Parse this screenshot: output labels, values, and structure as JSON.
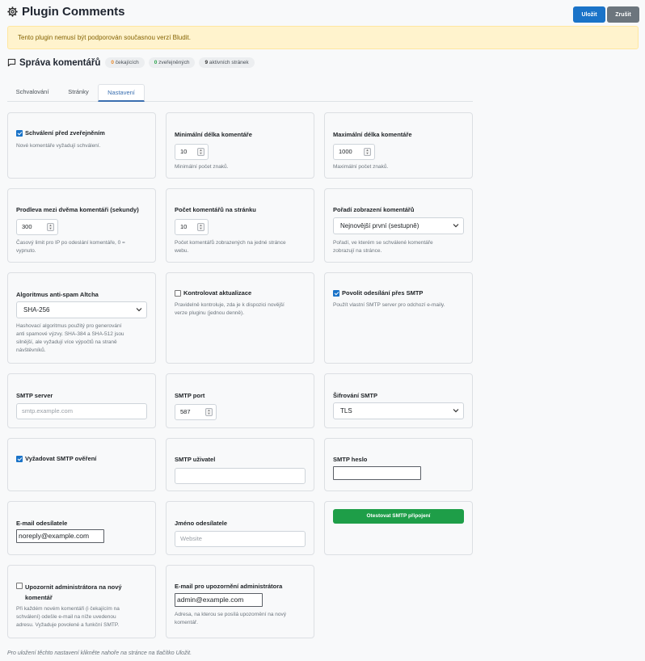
{
  "header": {
    "title": "Plugin Comments",
    "save_label": "Uložit",
    "cancel_label": "Zrušit"
  },
  "alert": "Tento plugin nemusí být podporován současnou verzí Bludit.",
  "management": {
    "title": "Správa komentářů",
    "badges": [
      {
        "count": "0",
        "label": "čekajících",
        "color": "#e8892a"
      },
      {
        "count": "0",
        "label": "zveřejněných",
        "color": "#2aa44a"
      },
      {
        "count": "9",
        "label": "aktivních stránek",
        "color": "#333333"
      }
    ]
  },
  "tabs": [
    "Schvalování",
    "Stránky",
    "Nastavení"
  ],
  "active_tab": "Nastavení",
  "settings": {
    "approval": {
      "label": "Schválení před zveřejněním",
      "checked": true,
      "help": "Nové komentáře vyžadují schválení."
    },
    "min_length": {
      "label": "Minimální délka komentáře",
      "value": "10",
      "help": "Minimální počet znaků."
    },
    "max_length": {
      "label": "Maximální délka komentáře",
      "value": "1000",
      "help": "Maximální počet znaků."
    },
    "delay": {
      "label": "Prodleva mezi dvěma komentáři (sekundy)",
      "value": "300",
      "help1": "Časový limit pro IP po odeslání komentáře, 0 =",
      "help2": "vypnuto."
    },
    "per_page": {
      "label": "Počet komentářů na stránku",
      "value": "10",
      "help1": "Počet komentářů zobrazených na jedné stránce",
      "help2": "webu."
    },
    "order": {
      "label": "Pořadí zobrazení komentářů",
      "value": "Nejnovější první (sestupně)",
      "help1": "Pořadí, ve kterém se schválené komentáře",
      "help2": "zobrazují na stránce."
    },
    "altcha": {
      "label": "Algoritmus anti-spam Altcha",
      "value": "SHA-256",
      "help1": "Hashovací algoritmus použitý pro generování",
      "help2": "anti spamové výzvy. SHA-384 a SHA-512 jsou",
      "help3": "silnější, ale vyžadují více výpočtů na straně",
      "help4": "návštěvníků."
    },
    "updates": {
      "label": "Kontrolovat aktualizace",
      "checked": false,
      "help1": "Pravidelně kontroluje, zda je k dispozici novější",
      "help2": "verze pluginu (jednou denně)."
    },
    "smtp_enable": {
      "label": "Povolit odesílání přes SMTP",
      "checked": true,
      "help": "Použít vlastní SMTP server pro odchozí e-maily."
    },
    "smtp_server": {
      "label": "SMTP server",
      "placeholder": "smtp.example.com"
    },
    "smtp_port": {
      "label": "SMTP port",
      "value": "587"
    },
    "smtp_encryption": {
      "label": "Šifrování SMTP",
      "value": "TLS"
    },
    "smtp_auth": {
      "label": "Vyžadovat SMTP ověření",
      "checked": true
    },
    "smtp_user": {
      "label": "SMTP uživatel",
      "value": ""
    },
    "smtp_pass": {
      "label": "SMTP heslo",
      "value": ""
    },
    "sender_email": {
      "label": "E-mail odesílatele",
      "value": "noreply@example.com"
    },
    "sender_name": {
      "label": "Jméno odesílatele",
      "placeholder": "Website"
    },
    "test_smtp": {
      "label": "Otestovat SMTP připojení"
    },
    "notify_admin": {
      "label1": "Upozornit administrátora na nový",
      "label2": "komentář",
      "checked": false,
      "help1": "Při každém novém komentáři (i čekajícím na",
      "help2": "schválení) odešle e-mail na níže uvedenou",
      "help3": "adresu. Vyžaduje povolené a funkční SMTP."
    },
    "admin_email": {
      "label": "E-mail pro upozornění administrátora",
      "value": "admin@example.com",
      "help1": "Adresa, na kterou se posílá upozornění na nový",
      "help2": "komentář."
    }
  },
  "footer_note": "Pro uložení těchto nastavení klikněte nahoře na stránce na tlačítko Uložit."
}
